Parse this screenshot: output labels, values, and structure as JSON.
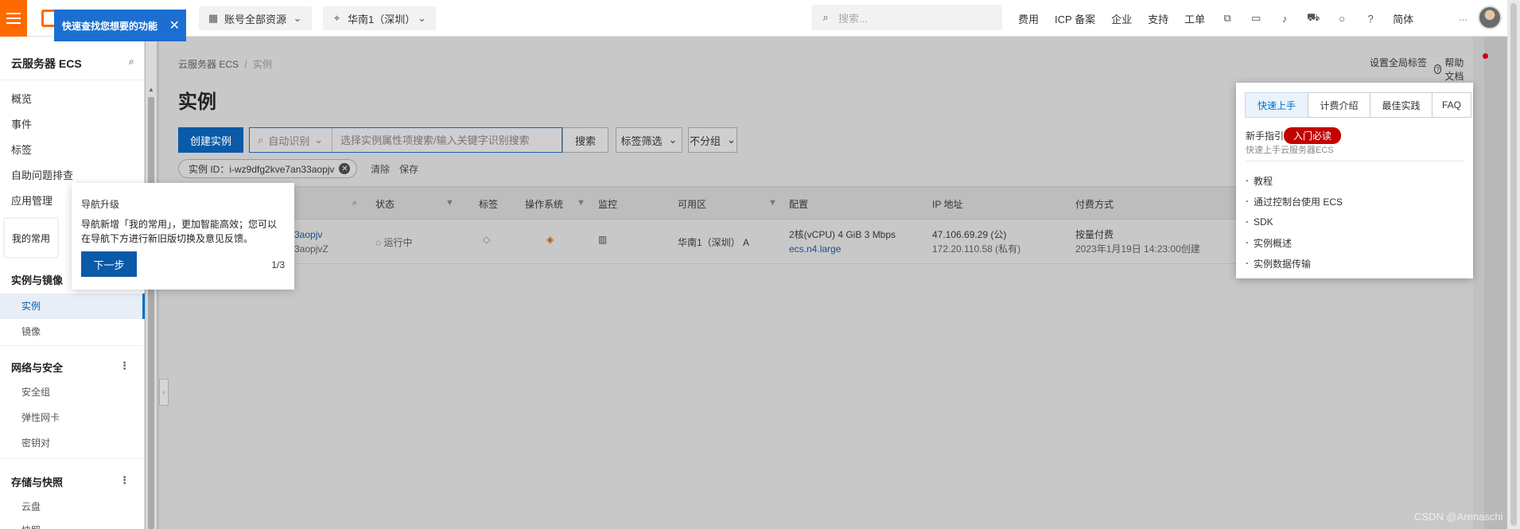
{
  "topbar": {
    "resource_select": "账号全部资源",
    "region_select": "华南1（深圳）",
    "search_placeholder": "搜索...",
    "links": [
      "费用",
      "ICP 备案",
      "企业",
      "支持",
      "工单"
    ],
    "lang": "简体",
    "more": "..."
  },
  "tooltip_blue": {
    "text": "快速查找您想要的功能",
    "close": "✕"
  },
  "sidebar": {
    "title": "云服务器 ECS",
    "items": [
      "概览",
      "事件",
      "标签",
      "自助问题排查",
      "应用管理"
    ],
    "favorites": "我的常用",
    "group_instances": "实例与镜像",
    "instances_items": [
      "实例",
      "镜像"
    ],
    "group_network": "网络与安全",
    "network_items": [
      "安全组",
      "弹性网卡",
      "密钥对"
    ],
    "group_storage": "存储与快照",
    "storage_items": [
      "云盘",
      "快照"
    ]
  },
  "guide": {
    "title": "导航升级",
    "body": "导航新增「我的常用」，更加智能高效；您可以在导航下方进行新旧版切换及意见反馈。",
    "next": "下一步",
    "step": "1/3"
  },
  "main": {
    "breadcrumb": [
      "云服务器 ECS",
      "实例"
    ],
    "breadcrumb_sep": "/",
    "title": "实例",
    "create_button": "创建实例",
    "search_mode": "自动识别",
    "search_placeholder": "选择实例属性项搜索/输入关键字识别搜索",
    "search_button": "搜索",
    "tag_filter": "标签筛选",
    "group_select": "不分组",
    "chip": "实例 ID：i-wz9dfg2kve7an33aopjv",
    "clear": "清除",
    "save": "保存",
    "global_tag": "设置全局标签",
    "help_doc": "帮助文档"
  },
  "table": {
    "headers": [
      "状态",
      "标签",
      "操作系统",
      "监控",
      "可用区",
      "配置",
      "IP 地址",
      "付费方式"
    ],
    "row": {
      "id_line1": "3aopjv",
      "id_line2": "3aopjvZ",
      "status": "运行中",
      "zone": "华南1（深圳） A",
      "config_line1": "2核(vCPU)  4 GiB  3 Mbps",
      "config_line2": "ecs.n4.large",
      "ip_public": "47.106.69.29 (公)",
      "ip_private": "172.20.110.58 (私有)",
      "pay_type": "按量付费",
      "created": "2023年1月19日 14:23:00创建"
    }
  },
  "help_popup": {
    "tabs": [
      "快速上手",
      "计费介绍",
      "最佳实践",
      "FAQ"
    ],
    "intro": "新手指引",
    "badge": "入门必读",
    "sub": "快速上手云服务器ECS",
    "links": [
      "教程",
      "通过控制台使用 ECS",
      "SDK",
      "实例概述",
      "实例数据传输"
    ]
  },
  "watermark": "CSDN @Arenaschi",
  "colors": {
    "brand_orange": "#ff6a00",
    "primary_blue": "#0a5aa8",
    "tooltip_blue": "#1c6fd1",
    "badge_red": "#c40000"
  }
}
